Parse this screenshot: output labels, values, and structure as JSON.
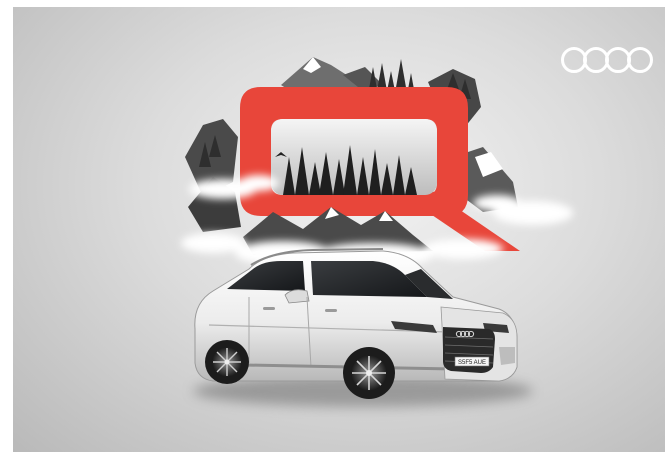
{
  "ad": {
    "brand_logo": "four-rings-logo",
    "emblem_letter": "Q",
    "plate_text": "S5F5 AUE",
    "colors": {
      "emblem_red": "#e8463a",
      "background": "#d6d6d6",
      "car_body": "#f0f0f0",
      "logo": "#ffffff"
    }
  }
}
